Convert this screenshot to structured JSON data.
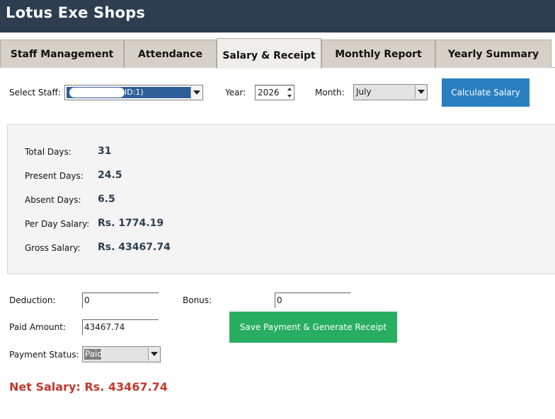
{
  "app": {
    "title": "Lotus Exe Shops"
  },
  "tabs": [
    {
      "label": "Staff Management",
      "active": false
    },
    {
      "label": "Attendance",
      "active": false
    },
    {
      "label": "Salary & Receipt",
      "active": true
    },
    {
      "label": "Monthly Report",
      "active": false
    },
    {
      "label": "Yearly Summary",
      "active": false
    }
  ],
  "controls": {
    "staff_label": "Select Staff:",
    "staff_value": "ID:1)",
    "year_label": "Year:",
    "year_value": "2026",
    "month_label": "Month:",
    "month_value": "July",
    "calc_button": "Calculate Salary"
  },
  "summary": {
    "total_days_label": "Total Days:",
    "total_days": "31",
    "present_days_label": "Present Days:",
    "present_days": "24.5",
    "absent_days_label": "Absent Days:",
    "absent_days": "6.5",
    "per_day_label": "Per Day Salary:",
    "per_day": "Rs. 1774.19",
    "gross_label": "Gross Salary:",
    "gross": "Rs. 43467.74"
  },
  "payment": {
    "deduction_label": "Deduction:",
    "deduction_value": "0",
    "bonus_label": "Bonus:",
    "bonus_value": "0",
    "paid_label": "Paid Amount:",
    "paid_value": "43467.74",
    "status_label": "Payment Status:",
    "status_value": "Paid",
    "save_button": "Save Payment & Generate Receipt",
    "net_salary": "Net Salary: Rs. 43467.74"
  },
  "colors": {
    "header_bg": "#2c3e50",
    "primary_button": "#2a7fc0",
    "save_button": "#27ae60",
    "net_salary": "#c0392b"
  }
}
